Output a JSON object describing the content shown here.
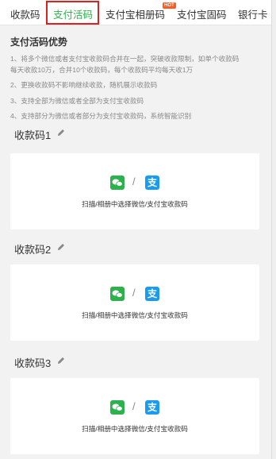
{
  "tabs": [
    {
      "label": "收款码",
      "active": false
    },
    {
      "label": "支付活码",
      "active": true
    },
    {
      "label": "支付宝相册码",
      "active": false
    },
    {
      "label": "支付宝固码",
      "active": false
    },
    {
      "label": "银行卡",
      "active": false
    }
  ],
  "hot_badge": "HOT",
  "advantages": {
    "title": "支付活码优势",
    "items": [
      "1、将多个微信或者支付宝收款码合并在一起，突破收款限制，如单个收款码",
      "每天收款10万，合并10个收款码，每个收款码平均每天收1万",
      "2、更换收款码不影响继续收款，随机展示收款码",
      "3、支持全部为微信或者全部为支付宝收款码",
      "4、支持部分为微信或者部分为支付宝收款码，系统智能识别"
    ]
  },
  "cards": [
    {
      "label": "收款码1",
      "hint": "扫描/相册中选择微信/支付宝收款码"
    },
    {
      "label": "收款码2",
      "hint": "扫描/相册中选择微信/支付宝收款码"
    },
    {
      "label": "收款码3",
      "hint": "扫描/相册中选择微信/支付宝收款码"
    }
  ],
  "icons": {
    "wechat": "wechat-icon",
    "alipay": "alipay-icon",
    "edit": "pencil-icon",
    "alipay_glyph": "支"
  },
  "colors": {
    "accent": "#2bb24c",
    "highlight": "#e02020",
    "alipay": "#1a9af0"
  }
}
